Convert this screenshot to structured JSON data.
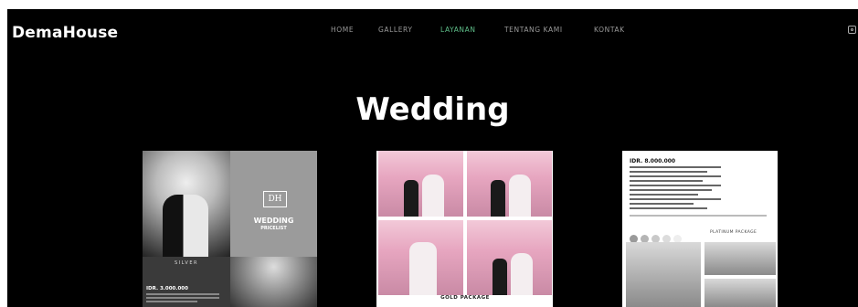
{
  "header": {
    "brand": "DemaHouse",
    "nav": [
      {
        "label": "HOME",
        "active": false
      },
      {
        "label": "GALLERY",
        "active": false
      },
      {
        "label": "LAYANAN",
        "active": true
      },
      {
        "label": "TENTANG KAMI",
        "active": false
      },
      {
        "label": "KONTAK",
        "active": false
      }
    ],
    "social_icon": "instagram-icon",
    "active_color": "#5fbf8a"
  },
  "main": {
    "title": "Wedding",
    "cards": [
      {
        "logo_text": "DH",
        "heading": "WEDDING",
        "subheading": "PRICELIST",
        "package_label": "SILVER",
        "price": "IDR. 3.000.000"
      },
      {
        "package_label": "GOLD PACKAGE"
      },
      {
        "price": "IDR. 8.000.000",
        "package_label": "PLATINUM PACKAGE",
        "swatches": [
          "#9a9a9a",
          "#b5b5b5",
          "#c9c9c9",
          "#dcdcdc",
          "#eeeeee"
        ]
      }
    ]
  }
}
